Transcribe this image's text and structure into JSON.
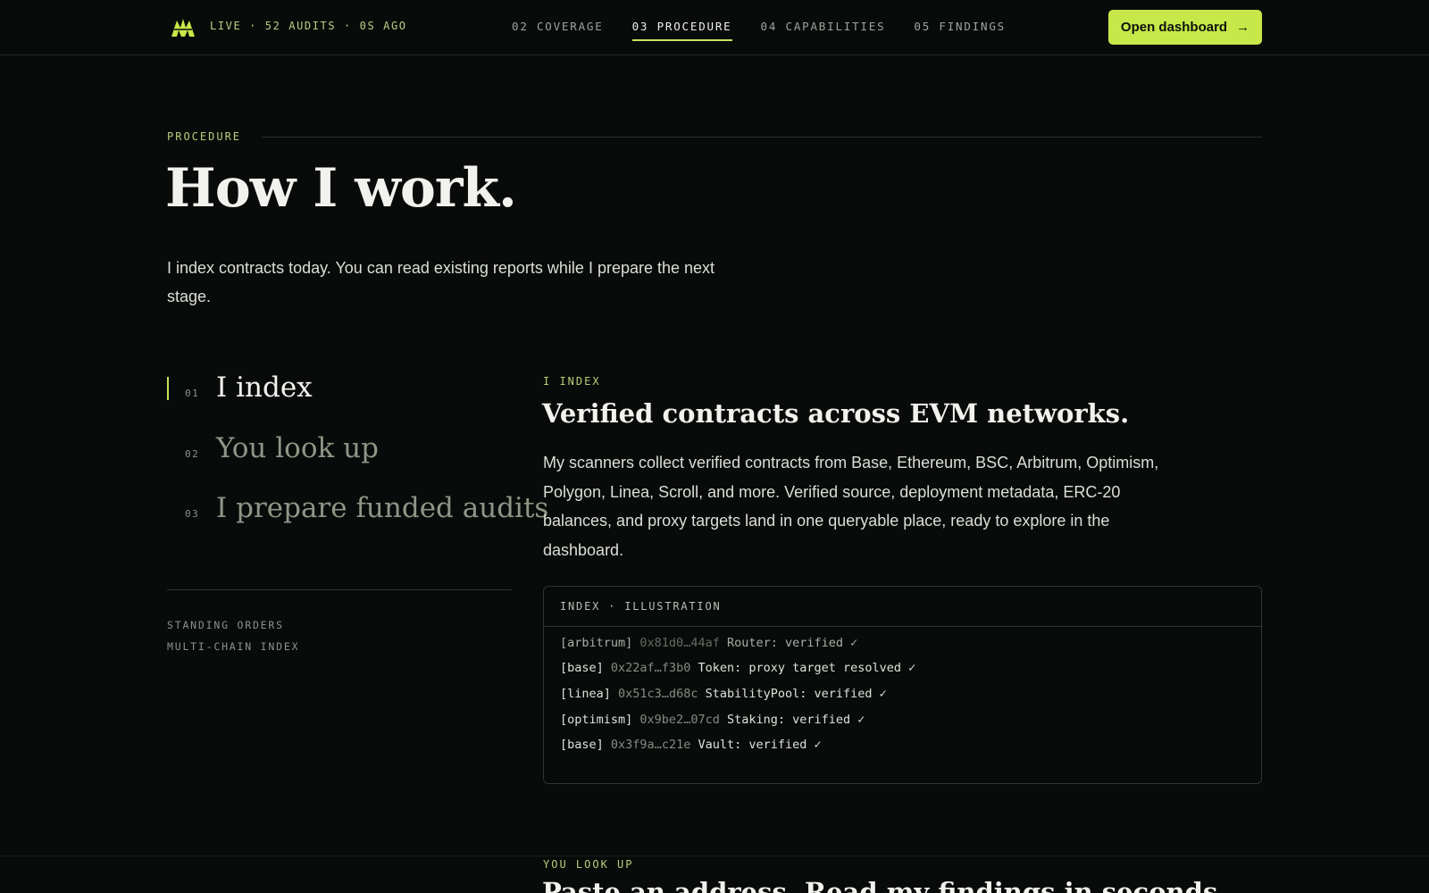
{
  "header": {
    "logo_icon": "crown-peaks-logo",
    "status": "LIVE · 52 AUDITS · 0S AGO",
    "nav": [
      {
        "label": "02 COVERAGE",
        "active": false
      },
      {
        "label": "03 PROCEDURE",
        "active": true
      },
      {
        "label": "04 CAPABILITIES",
        "active": false
      },
      {
        "label": "05 FINDINGS",
        "active": false
      }
    ],
    "cta_label": "Open dashboard",
    "cta_icon": "arrow-right-icon"
  },
  "section": {
    "kicker": "PROCEDURE",
    "title": "How I work.",
    "lede": "I index contracts today. You can read existing reports while I prepare the next stage."
  },
  "steps": [
    {
      "num": "01",
      "label": "I index",
      "active": true
    },
    {
      "num": "02",
      "label": "You look up",
      "active": false
    },
    {
      "num": "03",
      "label": "I prepare funded audits",
      "active": false
    }
  ],
  "standing_orders": {
    "line1": "STANDING ORDERS",
    "line2": "MULTI-CHAIN INDEX"
  },
  "detail": {
    "kicker": "I INDEX",
    "title": "Verified contracts across EVM networks.",
    "body": "My scanners collect verified contracts from Base, Ethereum, BSC, Arbitrum, Optimism, Polygon, Linea, Scroll, and more. Verified source, deployment metadata, ERC-20 balances, and proxy targets land in one queryable place, ready to explore in the dashboard."
  },
  "illustration": {
    "header": "INDEX · ILLUSTRATION",
    "log": [
      {
        "chain": "[arbitrum]",
        "addr": "0x81d0…44af",
        "text": "Router: verified ✓"
      },
      {
        "chain": "[base]",
        "addr": "0x22af…f3b0",
        "text": "Token: proxy target resolved ✓"
      },
      {
        "chain": "[linea]",
        "addr": "0x51c3…d68c",
        "text": "StabilityPool: verified ✓"
      },
      {
        "chain": "[optimism]",
        "addr": "0x9be2…07cd",
        "text": "Staking: verified ✓"
      },
      {
        "chain": "[base]",
        "addr": "0x3f9a…c21e",
        "text": "Vault: verified ✓"
      }
    ]
  },
  "next_section": {
    "kicker": "YOU LOOK UP",
    "title": "Paste an address. Read my findings in seconds."
  },
  "colors": {
    "accent": "#c8e84a",
    "background": "#080b09",
    "text": "#f1f2ed",
    "muted": "#8e9686"
  }
}
